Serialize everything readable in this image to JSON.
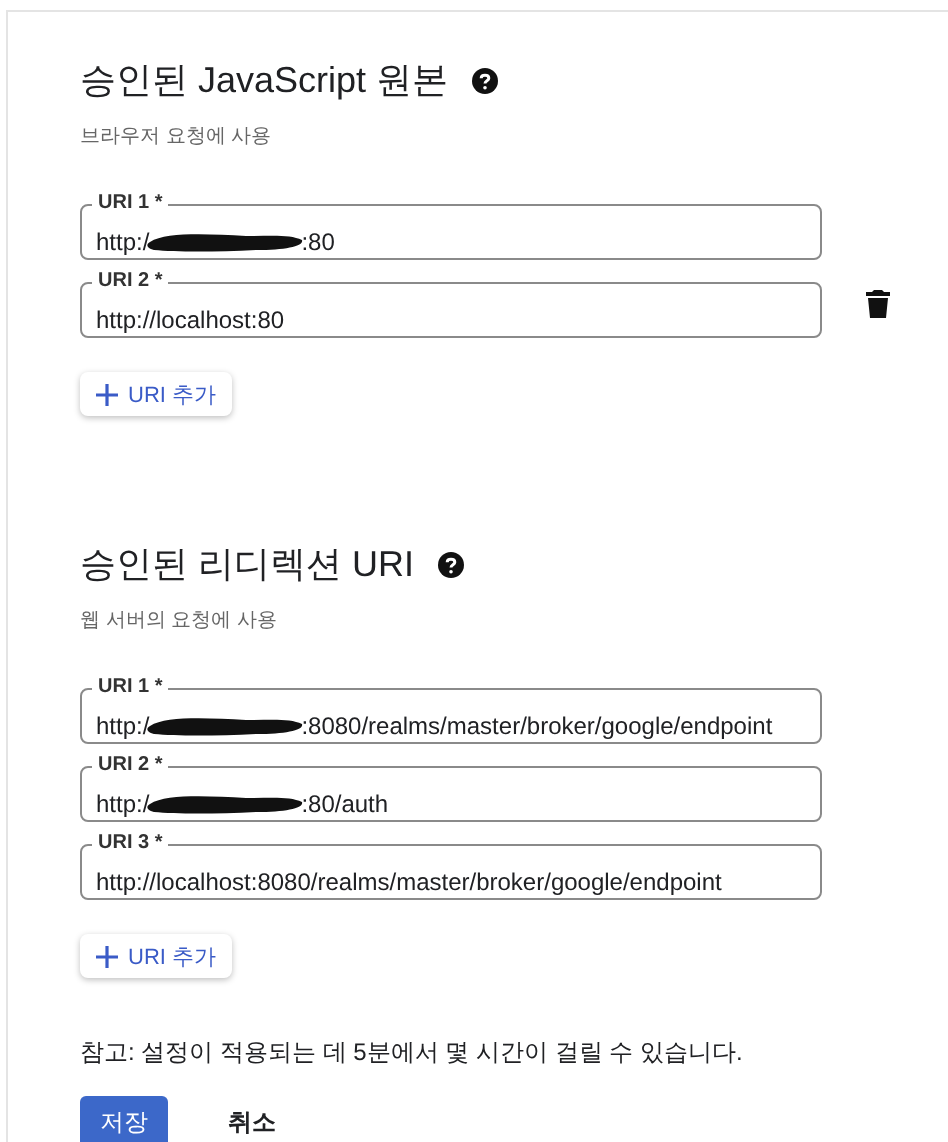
{
  "sections": [
    {
      "title": "승인된 JavaScript 원본",
      "subtitle": "브라우저 요청에 사용",
      "fields": [
        {
          "label": "URI 1 *",
          "value_start": "http:/",
          "redacted": true,
          "value_end": ":80",
          "deletable": false
        },
        {
          "label": "URI 2 *",
          "value_start": "http://localhost:80",
          "redacted": false,
          "deletable": true
        }
      ],
      "add_button": "URI 추가"
    },
    {
      "title": "승인된 리디렉션 URI",
      "subtitle": "웹 서버의 요청에 사용",
      "fields": [
        {
          "label": "URI 1 *",
          "value_start": "http:/",
          "redacted": true,
          "value_end": ":8080/realms/master/broker/google/endpoint",
          "deletable": false
        },
        {
          "label": "URI 2 *",
          "value_start": "http:/",
          "redacted": true,
          "value_end": ":80/auth",
          "deletable": false
        },
        {
          "label": "URI 3 *",
          "value_start": "http://localhost:8080/realms/master/broker/google/endpoint",
          "redacted": false,
          "deletable": false
        }
      ],
      "add_button": "URI 추가"
    }
  ],
  "note": "참고: 설정이 적용되는 데 5분에서 몇 시간이 걸릴 수 있습니다.",
  "buttons": [
    {
      "label": "저장",
      "kind": "primary"
    },
    {
      "label": "취소",
      "kind": "text"
    }
  ]
}
